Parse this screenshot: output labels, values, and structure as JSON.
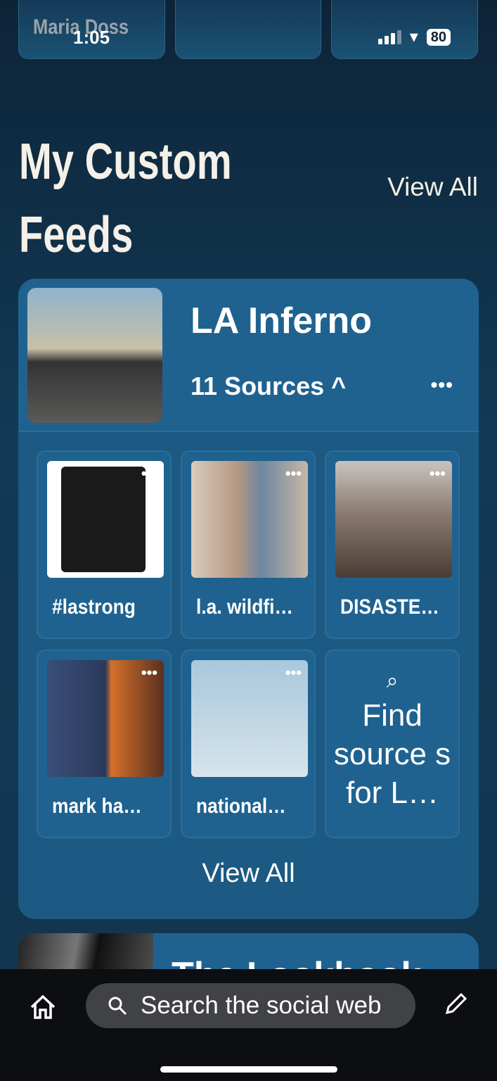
{
  "status_bar": {
    "behind_name": "Maria Doss",
    "time": "1:05",
    "battery": "80"
  },
  "section": {
    "title_line1": "My Custom",
    "title_line2": "Feeds",
    "view_all": "View All"
  },
  "feed": {
    "title": "LA Inferno",
    "sources": "11 Sources ^",
    "more": "•••",
    "view_all": "View All",
    "tiles": [
      {
        "label": "#lastrong",
        "more": "•••"
      },
      {
        "label": "l.a. wildfi…",
        "more": "•••"
      },
      {
        "label": "DISASTE…",
        "more": "•••"
      },
      {
        "label": "mark ha…",
        "more": "•••"
      },
      {
        "label": "national…",
        "more": "•••"
      }
    ],
    "find": {
      "icon": "search-icon",
      "text": "Find source s for L…"
    }
  },
  "next_feed": {
    "title": "The Lookbook"
  },
  "bottom_bar": {
    "search_placeholder": "Search the social web",
    "icons": [
      "home-icon",
      "search-icon",
      "pencil-icon"
    ]
  },
  "colors": {
    "card": "#1f6290",
    "background": "#123a55",
    "bottom": "#0d0e12"
  }
}
